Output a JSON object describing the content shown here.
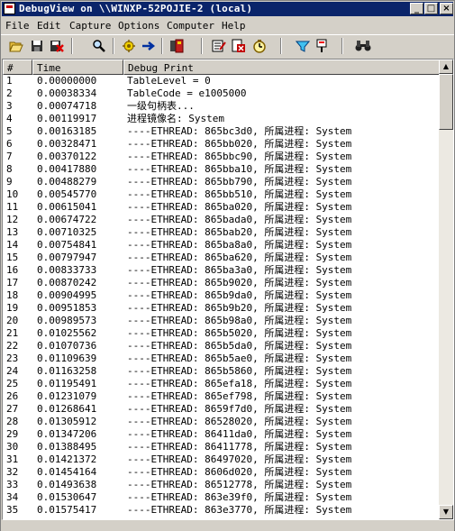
{
  "window": {
    "title": "DebugView on \\\\WINXP-52POJIE-2 (local)",
    "controls": {
      "minimize": "_",
      "maximize": "□",
      "close": "×"
    }
  },
  "menu": [
    "File",
    "Edit",
    "Capture",
    "Options",
    "Computer",
    "Help"
  ],
  "toolbar": {
    "icons": [
      "open-icon",
      "save-icon",
      "clear-icon",
      "find-icon",
      "capture-icon",
      "autoscroll-icon",
      "clear-display-icon",
      "options-icon",
      "log-icon",
      "timer-icon",
      "filter-icon",
      "highlight-icon",
      "binoculars-icon"
    ]
  },
  "columns": [
    "#",
    "Time",
    "Debug Print"
  ],
  "rows": [
    [
      "1",
      "0.00000000",
      "TableLevel = 0"
    ],
    [
      "2",
      "0.00038334",
      "TableCode = e1005000"
    ],
    [
      "3",
      "0.00074718",
      "一级句柄表..."
    ],
    [
      "4",
      "0.00119917",
      "进程镜像名: System"
    ],
    [
      "5",
      "0.00163185",
      "----ETHREAD: 865bc3d0, 所属进程: System"
    ],
    [
      "6",
      "0.00328471",
      "----ETHREAD: 865bb020, 所属进程: System"
    ],
    [
      "7",
      "0.00370122",
      "----ETHREAD: 865bbc90, 所属进程: System"
    ],
    [
      "8",
      "0.00417880",
      "----ETHREAD: 865bba10, 所属进程: System"
    ],
    [
      "9",
      "0.00488279",
      "----ETHREAD: 865bb790, 所属进程: System"
    ],
    [
      "10",
      "0.00545770",
      "----ETHREAD: 865bb510, 所属进程: System"
    ],
    [
      "11",
      "0.00615041",
      "----ETHREAD: 865ba020, 所属进程: System"
    ],
    [
      "12",
      "0.00674722",
      "----ETHREAD: 865bada0, 所属进程: System"
    ],
    [
      "13",
      "0.00710325",
      "----ETHREAD: 865bab20, 所属进程: System"
    ],
    [
      "14",
      "0.00754841",
      "----ETHREAD: 865ba8a0, 所属进程: System"
    ],
    [
      "15",
      "0.00797947",
      "----ETHREAD: 865ba620, 所属进程: System"
    ],
    [
      "16",
      "0.00833733",
      "----ETHREAD: 865ba3a0, 所属进程: System"
    ],
    [
      "17",
      "0.00870242",
      "----ETHREAD: 865b9020, 所属进程: System"
    ],
    [
      "18",
      "0.00904995",
      "----ETHREAD: 865b9da0, 所属进程: System"
    ],
    [
      "19",
      "0.00951853",
      "----ETHREAD: 865b9b20, 所属进程: System"
    ],
    [
      "20",
      "0.00989573",
      "----ETHREAD: 865b98a0, 所属进程: System"
    ],
    [
      "21",
      "0.01025562",
      "----ETHREAD: 865b5020, 所属进程: System"
    ],
    [
      "22",
      "0.01070736",
      "----ETHREAD: 865b5da0, 所属进程: System"
    ],
    [
      "23",
      "0.01109639",
      "----ETHREAD: 865b5ae0, 所属进程: System"
    ],
    [
      "24",
      "0.01163258",
      "----ETHREAD: 865b5860, 所属进程: System"
    ],
    [
      "25",
      "0.01195491",
      "----ETHREAD: 865efa18, 所属进程: System"
    ],
    [
      "26",
      "0.01231079",
      "----ETHREAD: 865ef798, 所属进程: System"
    ],
    [
      "27",
      "0.01268641",
      "----ETHREAD: 8659f7d0, 所属进程: System"
    ],
    [
      "28",
      "0.01305912",
      "----ETHREAD: 86528020, 所属进程: System"
    ],
    [
      "29",
      "0.01347206",
      "----ETHREAD: 86411da0, 所属进程: System"
    ],
    [
      "30",
      "0.01388495",
      "----ETHREAD: 86411778, 所属进程: System"
    ],
    [
      "31",
      "0.01421372",
      "----ETHREAD: 86497020, 所属进程: System"
    ],
    [
      "32",
      "0.01454164",
      "----ETHREAD: 8606d020, 所属进程: System"
    ],
    [
      "33",
      "0.01493638",
      "----ETHREAD: 86512778, 所属进程: System"
    ],
    [
      "34",
      "0.01530647",
      "----ETHREAD: 863e39f0, 所属进程: System"
    ],
    [
      "35",
      "0.01575417",
      "----ETHREAD: 863e3770, 所属进程: System"
    ]
  ],
  "scrollbar": {
    "up": "▲",
    "down": "▼"
  }
}
